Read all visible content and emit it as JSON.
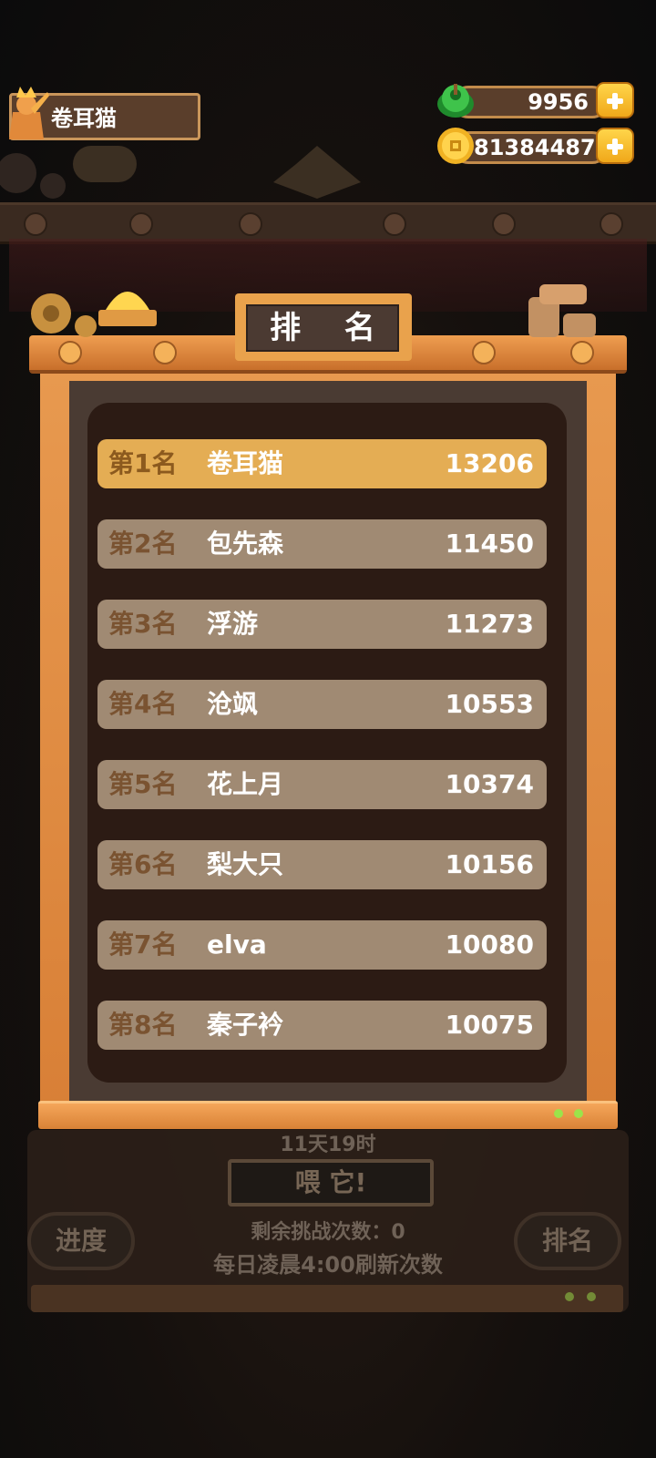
{
  "player": {
    "name": "卷耳猫"
  },
  "resources": {
    "gems": {
      "icon": "green-gem-icon",
      "value": "9956"
    },
    "coins": {
      "icon": "gold-coin-icon",
      "value": "81384487"
    }
  },
  "board": {
    "title": "排 名",
    "rows": [
      {
        "rank": "第1名",
        "name": "卷耳猫",
        "score": "13206"
      },
      {
        "rank": "第2名",
        "name": "包先森",
        "score": "11450"
      },
      {
        "rank": "第3名",
        "name": "浮游",
        "score": "11273"
      },
      {
        "rank": "第4名",
        "name": "沧飒",
        "score": "10553"
      },
      {
        "rank": "第5名",
        "name": "花上月",
        "score": "10374"
      },
      {
        "rank": "第6名",
        "name": "梨大只",
        "score": "10156"
      },
      {
        "rank": "第7名",
        "name": "elva",
        "score": "10080"
      },
      {
        "rank": "第8名",
        "name": "秦子衿",
        "score": "10075"
      }
    ]
  },
  "background": {
    "timer": "11天19时",
    "feed_button": "喂 它!",
    "remaining_attempts": "剩余挑战次数：0",
    "refresh_note": "每日凌晨4:00刷新次数",
    "progress_button": "进度",
    "ranking_button": "排名"
  },
  "colors": {
    "top_row": "#e4ad54",
    "row": "#a08a73",
    "frame": "#e89a50",
    "panel": "#2c1b14"
  }
}
